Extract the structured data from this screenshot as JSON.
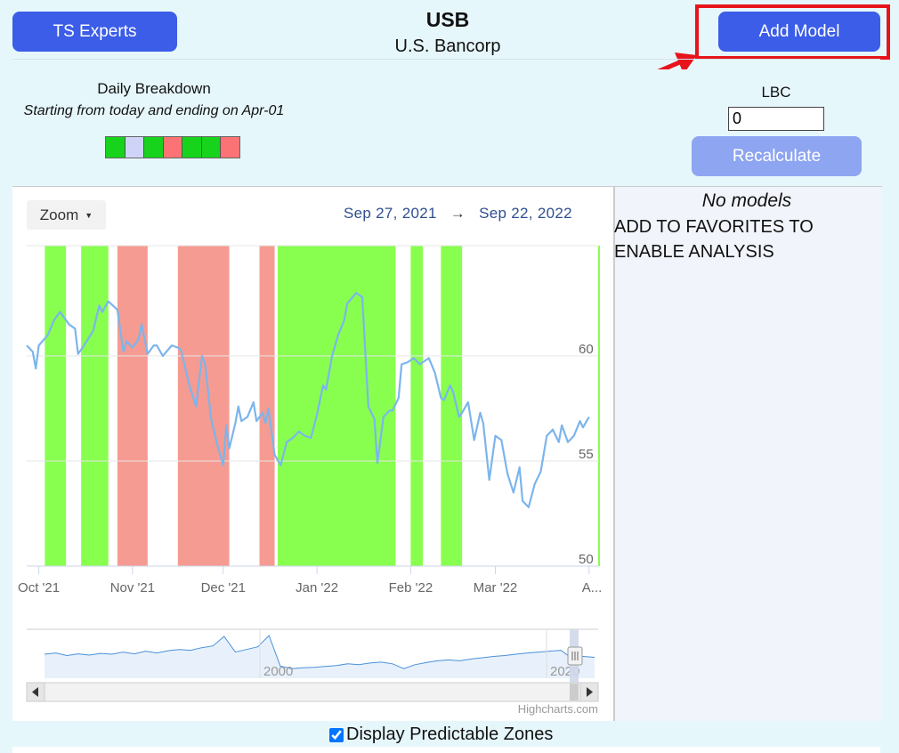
{
  "header": {
    "experts_button": "TS Experts",
    "ticker": "USB",
    "company": "U.S. Bancorp",
    "add_model_button": "Add Model"
  },
  "breakdown": {
    "title": "Daily Breakdown",
    "subtitle": "Starting from today and ending on Apr-01",
    "cells": [
      "#17d31c",
      "#cfd3f7",
      "#17d31c",
      "#fb7374",
      "#17d31c",
      "#17d31c",
      "#fb7374"
    ]
  },
  "lbc": {
    "label": "LBC",
    "value": "0",
    "recalculate_button": "Recalculate"
  },
  "side_panel": {
    "no_models": "No models",
    "message": "ADD TO FAVORITES TO ENABLE ANALYSIS"
  },
  "chart": {
    "zoom_label": "Zoom",
    "range_start": "Sep 27, 2021",
    "range_arrow": "→",
    "range_end": "Sep 22, 2022",
    "credit": "Highcharts.com",
    "navigator_labels": [
      "2000",
      "2020"
    ]
  },
  "chart_data": {
    "type": "line",
    "x_start": "2021-09-27",
    "x_end": "2022-04-04",
    "x_ticks": [
      {
        "date": "2021-10-01",
        "label": "Oct '21"
      },
      {
        "date": "2021-11-01",
        "label": "Nov '21"
      },
      {
        "date": "2021-12-01",
        "label": "Dec '21"
      },
      {
        "date": "2022-01-01",
        "label": "Jan '22"
      },
      {
        "date": "2022-02-01",
        "label": "Feb '22"
      },
      {
        "date": "2022-03-01",
        "label": "Mar '22"
      },
      {
        "date": "2022-04-01",
        "label": "A..."
      }
    ],
    "y_ticks": [
      50,
      55,
      60
    ],
    "ylim": [
      50,
      65.25
    ],
    "line_color": "#7cb5ec",
    "zone_colors": {
      "green": "#88ff4f",
      "red": "#f59b91"
    },
    "zones": [
      {
        "from": "2021-10-03",
        "to": "2021-10-10",
        "color": "green"
      },
      {
        "from": "2021-10-15",
        "to": "2021-10-24",
        "color": "green"
      },
      {
        "from": "2021-10-27",
        "to": "2021-11-06",
        "color": "red"
      },
      {
        "from": "2021-11-16",
        "to": "2021-12-03",
        "color": "red"
      },
      {
        "from": "2021-12-13",
        "to": "2021-12-18",
        "color": "red"
      },
      {
        "from": "2021-12-19",
        "to": "2022-01-27",
        "color": "green"
      },
      {
        "from": "2022-02-01",
        "to": "2022-02-05",
        "color": "green"
      },
      {
        "from": "2022-02-11",
        "to": "2022-02-18",
        "color": "green"
      },
      {
        "from": "2022-04-04",
        "to": "2022-04-04",
        "color": "green"
      }
    ],
    "series": [
      {
        "points": [
          [
            "2021-09-27",
            60.5
          ],
          [
            "2021-09-29",
            60.2
          ],
          [
            "2021-09-30",
            59.4
          ],
          [
            "2021-10-01",
            60.5
          ],
          [
            "2021-10-04",
            61.0
          ],
          [
            "2021-10-06",
            61.7
          ],
          [
            "2021-10-08",
            62.1
          ],
          [
            "2021-10-11",
            61.5
          ],
          [
            "2021-10-13",
            61.3
          ],
          [
            "2021-10-14",
            60.1
          ],
          [
            "2021-10-16",
            60.5
          ],
          [
            "2021-10-19",
            61.2
          ],
          [
            "2021-10-21",
            62.4
          ],
          [
            "2021-10-22",
            62.1
          ],
          [
            "2021-10-24",
            62.6
          ],
          [
            "2021-10-27",
            62.2
          ],
          [
            "2021-10-29",
            60.2
          ],
          [
            "2021-10-30",
            60.7
          ],
          [
            "2021-11-01",
            60.4
          ],
          [
            "2021-11-03",
            60.8
          ],
          [
            "2021-11-04",
            61.5
          ],
          [
            "2021-11-06",
            60.1
          ],
          [
            "2021-11-08",
            60.5
          ],
          [
            "2021-11-09",
            60.5
          ],
          [
            "2021-11-11",
            60.0
          ],
          [
            "2021-11-14",
            60.5
          ],
          [
            "2021-11-16",
            60.4
          ],
          [
            "2021-11-17",
            60.3
          ],
          [
            "2021-11-19",
            59.1
          ],
          [
            "2021-11-20",
            58.5
          ],
          [
            "2021-11-22",
            57.6
          ],
          [
            "2021-11-24",
            60.0
          ],
          [
            "2021-11-25",
            59.6
          ],
          [
            "2021-11-27",
            57.0
          ],
          [
            "2021-11-29",
            55.8
          ],
          [
            "2021-12-01",
            54.8
          ],
          [
            "2021-12-02",
            56.7
          ],
          [
            "2021-12-03",
            55.6
          ],
          [
            "2021-12-05",
            56.8
          ],
          [
            "2021-12-06",
            57.6
          ],
          [
            "2021-12-07",
            56.9
          ],
          [
            "2021-12-09",
            57.1
          ],
          [
            "2021-12-11",
            57.8
          ],
          [
            "2021-12-12",
            56.9
          ],
          [
            "2021-12-14",
            57.3
          ],
          [
            "2021-12-15",
            56.8
          ],
          [
            "2021-12-16",
            57.5
          ],
          [
            "2021-12-18",
            55.3
          ],
          [
            "2021-12-20",
            54.8
          ],
          [
            "2021-12-22",
            55.9
          ],
          [
            "2021-12-24",
            56.1
          ],
          [
            "2021-12-26",
            56.4
          ],
          [
            "2021-12-28",
            56.2
          ],
          [
            "2021-12-30",
            56.1
          ],
          [
            "2022-01-01",
            57.2
          ],
          [
            "2022-01-03",
            58.6
          ],
          [
            "2022-01-04",
            58.4
          ],
          [
            "2022-01-06",
            60.0
          ],
          [
            "2022-01-08",
            61.0
          ],
          [
            "2022-01-10",
            61.7
          ],
          [
            "2022-01-11",
            62.5
          ],
          [
            "2022-01-14",
            63.0
          ],
          [
            "2022-01-16",
            62.8
          ],
          [
            "2022-01-18",
            57.6
          ],
          [
            "2022-01-20",
            57.0
          ],
          [
            "2022-01-21",
            54.9
          ],
          [
            "2022-01-23",
            57.1
          ],
          [
            "2022-01-25",
            57.4
          ],
          [
            "2022-01-26",
            57.4
          ],
          [
            "2022-01-28",
            58.0
          ],
          [
            "2022-01-29",
            59.6
          ],
          [
            "2022-01-31",
            59.7
          ],
          [
            "2022-02-02",
            59.9
          ],
          [
            "2022-02-04",
            59.6
          ],
          [
            "2022-02-07",
            59.9
          ],
          [
            "2022-02-09",
            59.2
          ],
          [
            "2022-02-11",
            58.0
          ],
          [
            "2022-02-12",
            57.9
          ],
          [
            "2022-02-14",
            58.6
          ],
          [
            "2022-02-15",
            58.3
          ],
          [
            "2022-02-17",
            57.1
          ],
          [
            "2022-02-18",
            57.3
          ],
          [
            "2022-02-20",
            57.8
          ],
          [
            "2022-02-21",
            56.9
          ],
          [
            "2022-02-22",
            56.0
          ],
          [
            "2022-02-24",
            57.3
          ],
          [
            "2022-02-25",
            56.8
          ],
          [
            "2022-02-27",
            54.1
          ],
          [
            "2022-03-01",
            56.2
          ],
          [
            "2022-03-03",
            56.0
          ],
          [
            "2022-03-05",
            54.4
          ],
          [
            "2022-03-07",
            53.5
          ],
          [
            "2022-03-09",
            54.7
          ],
          [
            "2022-03-10",
            53.1
          ],
          [
            "2022-03-12",
            52.8
          ],
          [
            "2022-03-14",
            53.9
          ],
          [
            "2022-03-16",
            54.5
          ],
          [
            "2022-03-18",
            56.2
          ],
          [
            "2022-03-20",
            56.5
          ],
          [
            "2022-03-22",
            55.9
          ],
          [
            "2022-03-23",
            56.7
          ],
          [
            "2022-03-25",
            55.9
          ],
          [
            "2022-03-27",
            56.2
          ],
          [
            "2022-03-29",
            56.9
          ],
          [
            "2022-03-30",
            56.6
          ],
          [
            "2022-04-01",
            57.1
          ]
        ]
      }
    ],
    "navigator": {
      "points": [
        0.55,
        0.58,
        0.52,
        0.56,
        0.53,
        0.57,
        0.55,
        0.6,
        0.56,
        0.62,
        0.58,
        0.63,
        0.66,
        0.64,
        0.7,
        0.74,
        0.96,
        0.6,
        0.66,
        0.72,
        0.98,
        0.28,
        0.22,
        0.24,
        0.25,
        0.27,
        0.29,
        0.33,
        0.31,
        0.35,
        0.37,
        0.33,
        0.22,
        0.31,
        0.36,
        0.4,
        0.42,
        0.4,
        0.44,
        0.47,
        0.5,
        0.52,
        0.55,
        0.58,
        0.6,
        0.62,
        0.64,
        0.45,
        0.5,
        0.48
      ],
      "gridlines": [
        "2000",
        "2020"
      ]
    }
  }
}
